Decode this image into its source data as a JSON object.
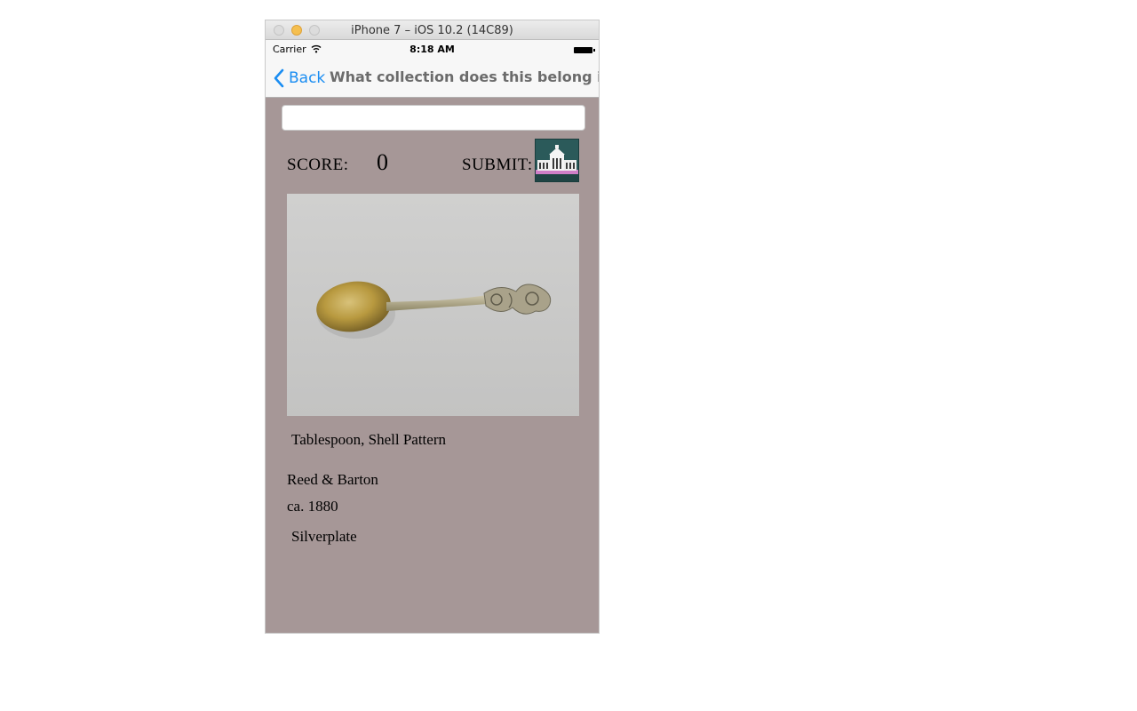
{
  "window": {
    "title": "iPhone 7 – iOS 10.2 (14C89)"
  },
  "status_bar": {
    "carrier": "Carrier",
    "time": "8:18 AM"
  },
  "nav": {
    "back_label": "Back",
    "title": "What collection does this belong in?"
  },
  "answer_input": {
    "value": "",
    "placeholder": ""
  },
  "score": {
    "label": "SCORE:",
    "value": "0"
  },
  "submit": {
    "label": "SUBMIT:",
    "icon": "museum-building-icon"
  },
  "artwork": {
    "title": "Tablespoon, Shell Pattern",
    "maker": "Reed & Barton",
    "date": "ca. 1880",
    "medium": "Silverplate"
  },
  "colors": {
    "app_background": "#a69797",
    "nav_background": "#f7f7f7",
    "back_link": "#1a8df2",
    "submit_background": "#2b5a5a"
  }
}
